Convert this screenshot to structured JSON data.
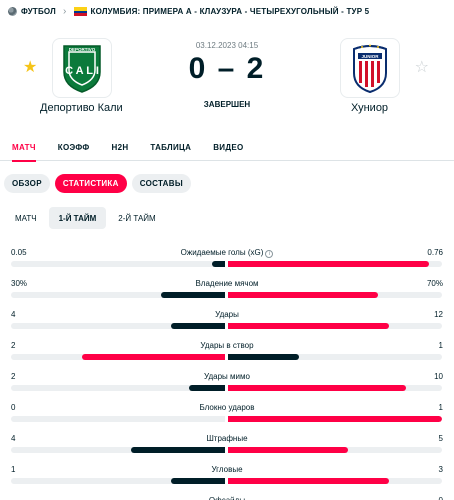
{
  "breadcrumb": {
    "sport": "ФУТБОЛ",
    "league": "КОЛУМБИЯ: ПРИМЕРА А - КЛАУЗУРА - ЧЕТЫРЕХУГОЛЬНЫЙ - ТУР 5"
  },
  "match": {
    "date": "03.12.2023 04:15",
    "score": "0 – 2",
    "status": "ЗАВЕРШЕН",
    "home": {
      "name": "Депортиво Кали",
      "logo_text": "DEPORTIVO",
      "logo_letters": "C A L I"
    },
    "away": {
      "name": "Хуниор",
      "logo_text": "JUNIOR"
    }
  },
  "tabs": [
    "МАТЧ",
    "КОЭФФ",
    "H2H",
    "ТАБЛИЦА",
    "ВИДЕО"
  ],
  "pills": [
    "ОБЗОР",
    "СТАТИСТИКА",
    "СОСТАВЫ"
  ],
  "periods": [
    "МАТЧ",
    "1-Й ТАЙМ",
    "2-Й ТАЙМ"
  ],
  "colors": {
    "accent": "#ff0046",
    "dark": "#001e28",
    "winner": "#ff0046",
    "loser": "#001e28",
    "track": "#eceff1"
  },
  "stats": [
    {
      "name": "Ожидаемые голы (xG)",
      "info": true,
      "home": "0.05",
      "away": "0.76",
      "home_share": 0.06,
      "away_share": 0.94,
      "leader": "away"
    },
    {
      "name": "Владение мячом",
      "home": "30%",
      "away": "70%",
      "home_share": 0.3,
      "away_share": 0.7,
      "leader": "away"
    },
    {
      "name": "Удары",
      "home": "4",
      "away": "12",
      "home_share": 0.25,
      "away_share": 0.75,
      "leader": "away"
    },
    {
      "name": "Удары в створ",
      "home": "2",
      "away": "1",
      "home_share": 0.67,
      "away_share": 0.33,
      "leader": "home"
    },
    {
      "name": "Удары мимо",
      "home": "2",
      "away": "10",
      "home_share": 0.17,
      "away_share": 0.83,
      "leader": "away"
    },
    {
      "name": "Блокно ударов",
      "home": "0",
      "away": "1",
      "home_share": 0.0,
      "away_share": 1.0,
      "leader": "away"
    },
    {
      "name": "Штрафные",
      "home": "4",
      "away": "5",
      "home_share": 0.44,
      "away_share": 0.56,
      "leader": "away"
    },
    {
      "name": "Угловые",
      "home": "1",
      "away": "3",
      "home_share": 0.25,
      "away_share": 0.75,
      "leader": "away"
    },
    {
      "name": "Офсайды",
      "home": "",
      "away": "0",
      "home_share": 0.0,
      "away_share": 0.0,
      "leader": "none"
    }
  ]
}
